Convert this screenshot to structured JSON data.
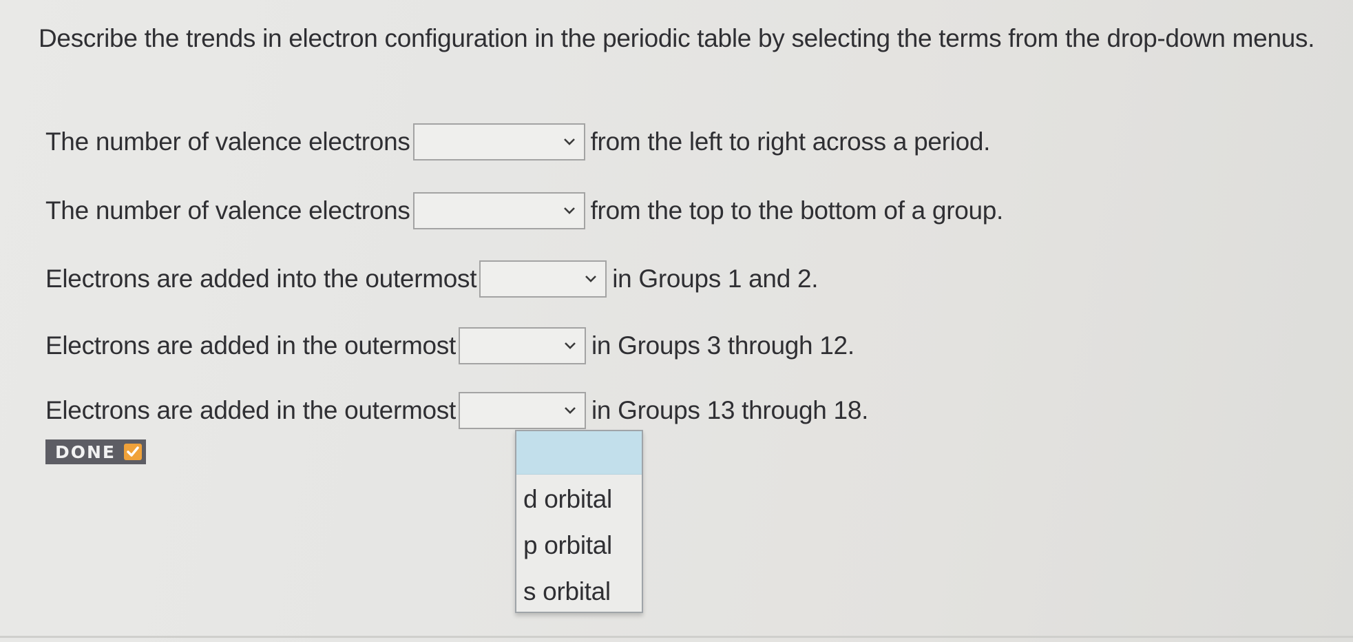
{
  "instructions": "Describe the trends in electron configuration in the periodic table by selecting the terms from the drop-down menus.",
  "questions": [
    {
      "before": "The number of valence electrons",
      "selected": "",
      "after": "from the left to right across a period."
    },
    {
      "before": "The number of valence electrons",
      "selected": "",
      "after": "from the top to the bottom of a group."
    },
    {
      "before": "Electrons are added into the outermost",
      "selected": "",
      "after": "in Groups 1 and 2."
    },
    {
      "before": "Electrons are added in the outermost",
      "selected": "",
      "after": "in Groups 3 through 12."
    },
    {
      "before": "Electrons are added in the outermost",
      "selected": "",
      "after": "in Groups 13 through 18."
    }
  ],
  "done_button": {
    "label": "DONE"
  },
  "open_dropdown": {
    "options": [
      "",
      "d orbital",
      "p orbital",
      "s orbital"
    ]
  },
  "colors": {
    "done_bg": "#5d5d64",
    "done_check": "#f0a23a",
    "highlight": "#c2dfeb"
  },
  "icons": {
    "select_arrow": "chevron-down-icon",
    "done_check": "checkmark-icon"
  }
}
